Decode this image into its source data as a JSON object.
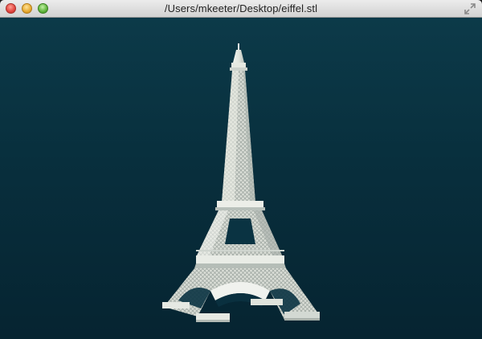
{
  "window": {
    "title": "/Users/mkeeter/Desktop/eiffel.stl",
    "buttons": {
      "close": "close-icon",
      "minimize": "minimize-icon",
      "zoom": "zoom-icon",
      "fullscreen": "fullscreen-arrows-icon"
    }
  },
  "viewport": {
    "background_top": "#0c3a49",
    "background_bottom": "#062431",
    "model_color": "#e8ebe4",
    "model_shade": "#b9c0ba"
  }
}
